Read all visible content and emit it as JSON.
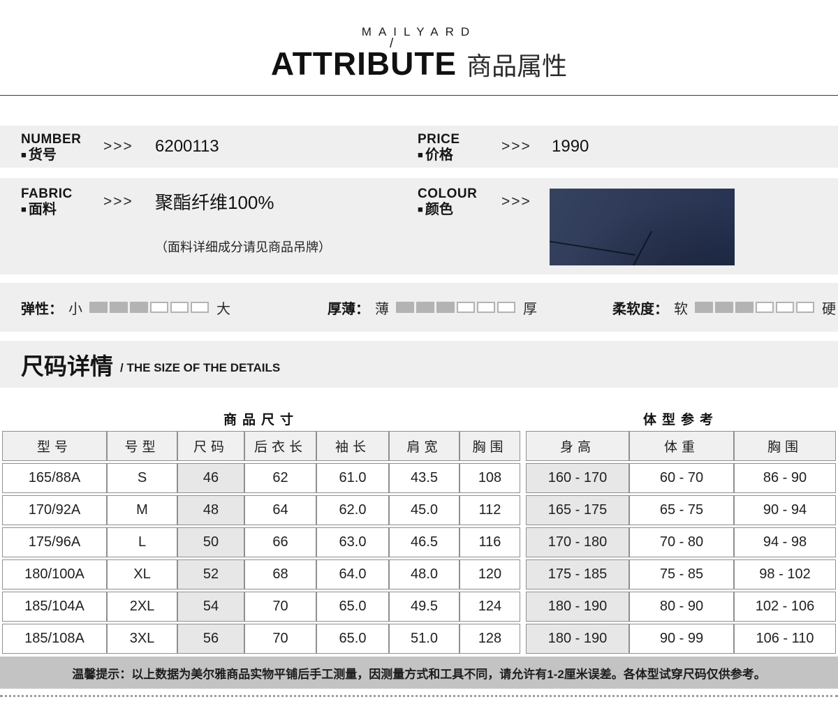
{
  "header": {
    "brand": "MAILYARD",
    "slash": "/",
    "title_en": "ATTRIBUTE",
    "title_zh": "商品属性"
  },
  "attributes": {
    "bullet": "■",
    "number": {
      "label_en": "NUMBER",
      "label_zh": "货号",
      "arrows": ">>>",
      "value": "6200113"
    },
    "price": {
      "label_en": "PRICE",
      "label_zh": "价格",
      "arrows": ">>>",
      "value": "1990"
    },
    "fabric": {
      "label_en": "FABRIC",
      "label_zh": "面料",
      "arrows": ">>>",
      "value": "聚酯纤维100%",
      "note": "（面料详细成分请见商品吊牌）"
    },
    "colour": {
      "label_en": "COLOUR",
      "label_zh": "颜色",
      "arrows": ">>>",
      "swatch_color": "#2e3a58"
    }
  },
  "scales": [
    {
      "label": "弹性：",
      "min": "小",
      "max": "大",
      "filled": 3,
      "total": 6
    },
    {
      "label": "厚薄：",
      "min": "薄",
      "max": "厚",
      "filled": 3,
      "total": 6
    },
    {
      "label": "柔软度：",
      "min": "软",
      "max": "硬",
      "filled": 3,
      "total": 6
    }
  ],
  "size_section": {
    "title_zh": "尺码详情",
    "title_en": "/ THE SIZE OF THE DETAILS",
    "left_table": {
      "title": "商品尺寸",
      "headers": [
        "型号",
        "号型",
        "尺码",
        "后衣长",
        "袖长",
        "肩宽",
        "胸围"
      ],
      "shaded_column": 2,
      "rows": [
        [
          "165/88A",
          "S",
          "46",
          "62",
          "61.0",
          "43.5",
          "108"
        ],
        [
          "170/92A",
          "M",
          "48",
          "64",
          "62.0",
          "45.0",
          "112"
        ],
        [
          "175/96A",
          "L",
          "50",
          "66",
          "63.0",
          "46.5",
          "116"
        ],
        [
          "180/100A",
          "XL",
          "52",
          "68",
          "64.0",
          "48.0",
          "120"
        ],
        [
          "185/104A",
          "2XL",
          "54",
          "70",
          "65.0",
          "49.5",
          "124"
        ],
        [
          "185/108A",
          "3XL",
          "56",
          "70",
          "65.0",
          "51.0",
          "128"
        ]
      ]
    },
    "right_table": {
      "title": "体型参考",
      "headers": [
        "身高",
        "体重",
        "胸围"
      ],
      "shaded_column": 0,
      "rows": [
        [
          "160 - 170",
          "60 - 70",
          "86 - 90"
        ],
        [
          "165 - 175",
          "65 - 75",
          "90 - 94"
        ],
        [
          "170 - 180",
          "70 - 80",
          "94 - 98"
        ],
        [
          "175 - 185",
          "75 - 85",
          "98 - 102"
        ],
        [
          "180 - 190",
          "80 - 90",
          "102 - 106"
        ],
        [
          "180 - 190",
          "90 - 99",
          "106 - 110"
        ]
      ]
    },
    "note": "温馨提示：以上数据为美尔雅商品实物平铺后手工测量，因测量方式和工具不同，请允许有1-2厘米误差。各体型试穿尺码仅供参考。"
  },
  "colors": {
    "section_bg": "#efefef",
    "table_header_bg": "#f0f0f0",
    "shaded_cell_bg": "#e7e7e7",
    "note_bar_bg": "#c3c3c3",
    "swatch_navy": "#2e3a58",
    "table_border": "#8f8f8f"
  }
}
